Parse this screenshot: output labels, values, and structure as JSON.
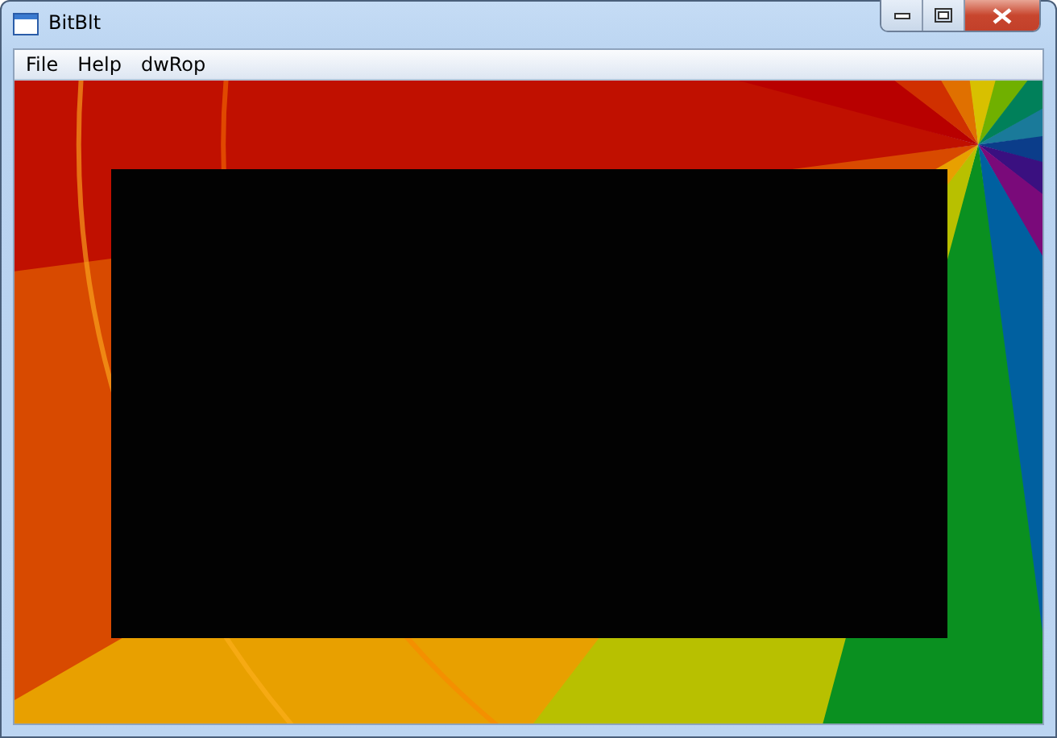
{
  "window": {
    "title": "BitBlt"
  },
  "menu": [
    {
      "label": "File"
    },
    {
      "label": "Help"
    },
    {
      "label": "dwRop"
    }
  ]
}
